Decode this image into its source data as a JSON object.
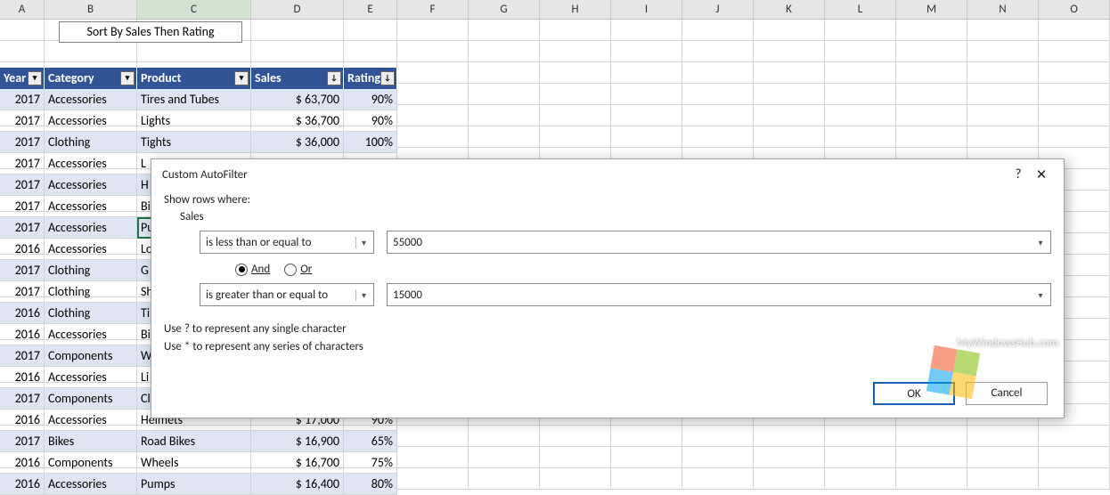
{
  "columns": [
    "A",
    "B",
    "C",
    "D",
    "E",
    "F",
    "G",
    "H",
    "I",
    "J",
    "K",
    "L",
    "M",
    "N",
    "O"
  ],
  "col_widths": [
    "w-A",
    "w-B",
    "w-C",
    "w-D",
    "w-E",
    "w-std",
    "w-std",
    "w-std",
    "w-std",
    "w-std",
    "w-std",
    "w-std",
    "w-std",
    "w-std",
    "w-std"
  ],
  "sort_button": "Sort By Sales Then Rating",
  "headers": {
    "year": "Year",
    "category": "Category",
    "product": "Product",
    "sales": "Sales",
    "rating": "Rating"
  },
  "rows": [
    {
      "year": "2017",
      "category": "Accessories",
      "product": "Tires and Tubes",
      "sales": "$ 63,700",
      "rating": "90%"
    },
    {
      "year": "2017",
      "category": "Accessories",
      "product": "Lights",
      "sales": "$ 36,700",
      "rating": "90%"
    },
    {
      "year": "2017",
      "category": "Clothing",
      "product": "Tights",
      "sales": "$ 36,000",
      "rating": "100%"
    },
    {
      "year": "2017",
      "category": "Accessories",
      "product": "L",
      "sales": "",
      "rating": ""
    },
    {
      "year": "2017",
      "category": "Accessories",
      "product": "H",
      "sales": "",
      "rating": ""
    },
    {
      "year": "2017",
      "category": "Accessories",
      "product": "Bi",
      "sales": "",
      "rating": ""
    },
    {
      "year": "2017",
      "category": "Accessories",
      "product": "Pu",
      "sales": "",
      "rating": ""
    },
    {
      "year": "2016",
      "category": "Accessories",
      "product": "Lo",
      "sales": "",
      "rating": ""
    },
    {
      "year": "2017",
      "category": "Clothing",
      "product": "G",
      "sales": "",
      "rating": ""
    },
    {
      "year": "2017",
      "category": "Clothing",
      "product": "Sh",
      "sales": "",
      "rating": ""
    },
    {
      "year": "2016",
      "category": "Clothing",
      "product": "Ti",
      "sales": "",
      "rating": ""
    },
    {
      "year": "2016",
      "category": "Accessories",
      "product": "Bi",
      "sales": "",
      "rating": ""
    },
    {
      "year": "2017",
      "category": "Components",
      "product": "W",
      "sales": "",
      "rating": ""
    },
    {
      "year": "2016",
      "category": "Accessories",
      "product": "Li",
      "sales": "",
      "rating": ""
    },
    {
      "year": "2017",
      "category": "Components",
      "product": "Cl",
      "sales": "",
      "rating": ""
    },
    {
      "year": "2016",
      "category": "Accessories",
      "product": "Helmets",
      "sales": "$ 17,000",
      "rating": "90%"
    },
    {
      "year": "2017",
      "category": "Bikes",
      "product": "Road Bikes",
      "sales": "$ 16,900",
      "rating": "65%"
    },
    {
      "year": "2016",
      "category": "Components",
      "product": "Wheels",
      "sales": "$ 16,700",
      "rating": "75%"
    },
    {
      "year": "2016",
      "category": "Accessories",
      "product": "Pumps",
      "sales": "$ 16,400",
      "rating": "80%"
    }
  ],
  "dialog": {
    "title": "Custom AutoFilter",
    "show_rows": "Show rows where:",
    "field": "Sales",
    "op1": "is less than or equal to",
    "val1": "55000",
    "and": "And",
    "or": "Or",
    "and_selected": true,
    "op2": "is greater than or equal to",
    "val2": "15000",
    "hint1": "Use ? to represent any single character",
    "hint2": "Use * to represent any series of characters",
    "ok": "OK",
    "cancel": "Cancel",
    "help": "?",
    "close": "✕"
  },
  "watermark": "MyWindowsHub.com"
}
